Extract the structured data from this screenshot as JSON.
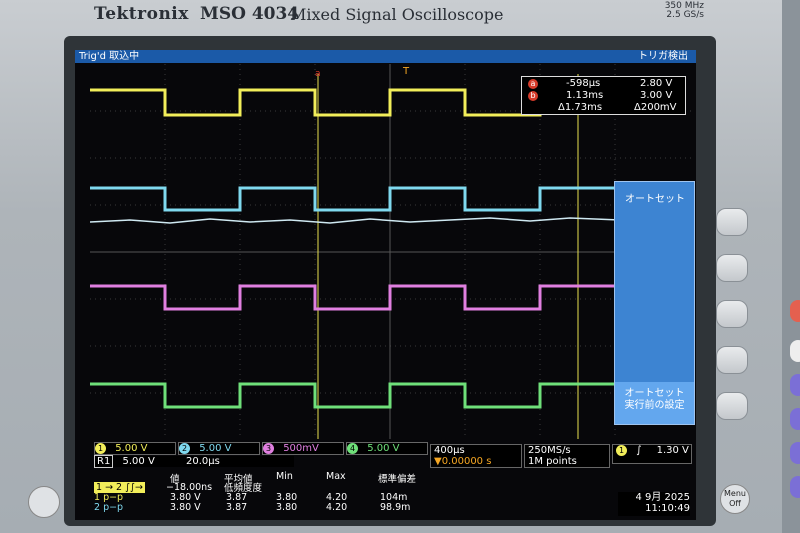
{
  "brand": {
    "name": "Tektronix",
    "model": "MSO 4034",
    "desc": "Mixed Signal Oscilloscope",
    "spec1": "350 MHz",
    "spec2": "2.5 GS/s"
  },
  "topbar": {
    "status": "Trig'd 取込中",
    "trigger": "トリガ検出"
  },
  "cursor": {
    "a_time": "-598µs",
    "a_volt": "2.80 V",
    "b_time": "1.13ms",
    "b_volt": "3.00 V",
    "d_time": "Δ1.73ms",
    "d_volt": "Δ200mV"
  },
  "menu": {
    "title": "オートセット",
    "undo_line1": "オートセット",
    "undo_line2": "実行前の設定"
  },
  "channels": [
    {
      "num": "1",
      "scale": "5.00 V",
      "color": "#f2ee5a"
    },
    {
      "num": "2",
      "scale": "5.00 V",
      "color": "#7fd9ef"
    },
    {
      "num": "3",
      "scale": "500mV",
      "color": "#e07fe0"
    },
    {
      "num": "4",
      "scale": "5.00 V",
      "color": "#6fe07a"
    }
  ],
  "ref": {
    "label": "R1",
    "scale": "5.00 V",
    "time": "20.0µs"
  },
  "timebase": {
    "scale": "400µs",
    "delay": "▼0.00000 s",
    "rate": "250MS/s",
    "points": "1M points"
  },
  "trigger": {
    "src": "1",
    "slope": "∫",
    "level": "1.30 V"
  },
  "datetime": {
    "date": "4 9月  2025",
    "time": "11:10:49"
  },
  "measure": {
    "headers": [
      "値",
      "平均値",
      "Min",
      "Max",
      "標準偏差"
    ],
    "header_sub": "低頻度度",
    "rows": [
      {
        "label": "1 → 2 ∫∫→",
        "value": "−18.00ns",
        "mean": "",
        "min": "",
        "max": "",
        "std": ""
      },
      {
        "label": "1 p−p",
        "value": "3.80 V",
        "mean": "3.87",
        "min": "3.80",
        "max": "4.20",
        "std": "104m"
      },
      {
        "label": "2 p−p",
        "value": "3.80 V",
        "mean": "3.87",
        "min": "3.80",
        "max": "4.20",
        "std": "98.9m"
      }
    ]
  },
  "front": {
    "menu_off_1": "Menu",
    "menu_off_2": "Off"
  }
}
